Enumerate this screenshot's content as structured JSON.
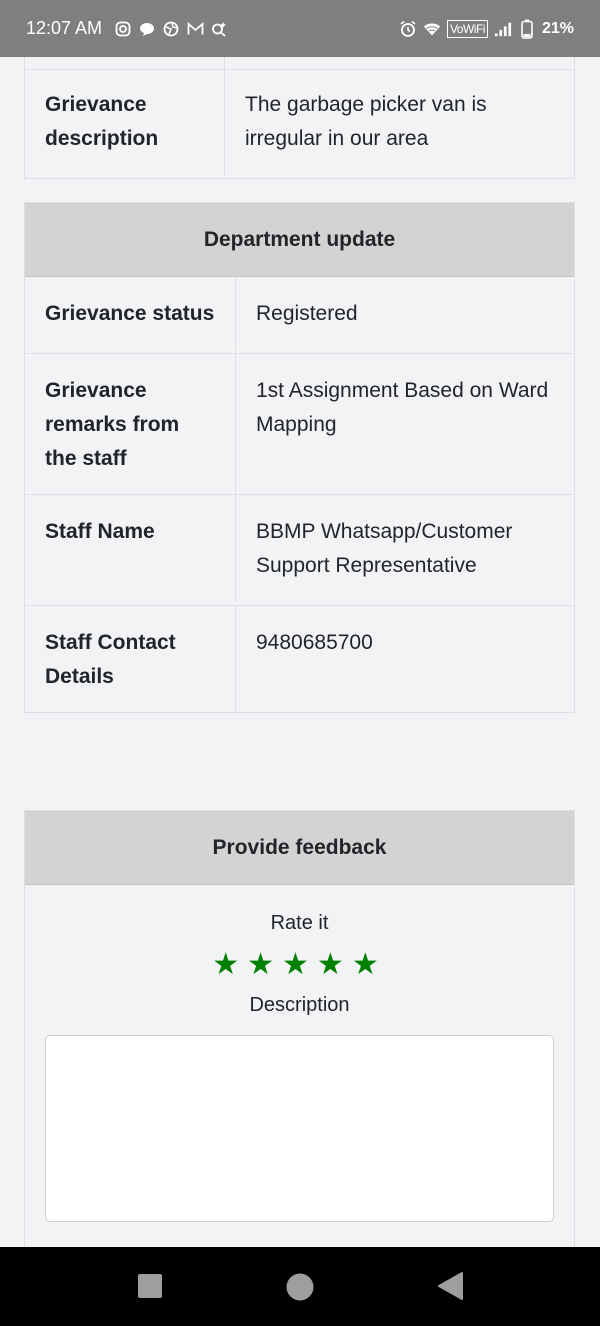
{
  "status_bar": {
    "time": "12:07 AM",
    "vowifi": "VoWiFi",
    "battery": "21%",
    "icons": [
      "instagram-icon",
      "chat-bubble-icon",
      "globe-icon",
      "gmail-icon",
      "search-sparkle-icon",
      "alarm-icon",
      "wifi-icon",
      "signal-icon",
      "battery-icon"
    ]
  },
  "grievance_table": {
    "rows": [
      {
        "label": "Grievance description",
        "value": "The garbage picker van is irregular in our area"
      }
    ]
  },
  "department_update": {
    "title": "Department update",
    "rows": [
      {
        "label": "Grievance status",
        "value": "Registered"
      },
      {
        "label": "Grievance remarks from the staff",
        "value": "1st Assignment Based on Ward Mapping"
      },
      {
        "label": "Staff Name",
        "value": "BBMP Whatsapp/Customer Support Representative"
      },
      {
        "label": "Staff Contact Details",
        "value": "9480685700"
      }
    ]
  },
  "feedback": {
    "title": "Provide feedback",
    "rate_label": "Rate it",
    "stars": "★★★★★",
    "star_color": "#008000",
    "description_label": "Description",
    "description_value": ""
  },
  "nav_bar": {
    "icons": [
      "recents-square-icon",
      "home-circle-icon",
      "back-triangle-icon"
    ]
  }
}
